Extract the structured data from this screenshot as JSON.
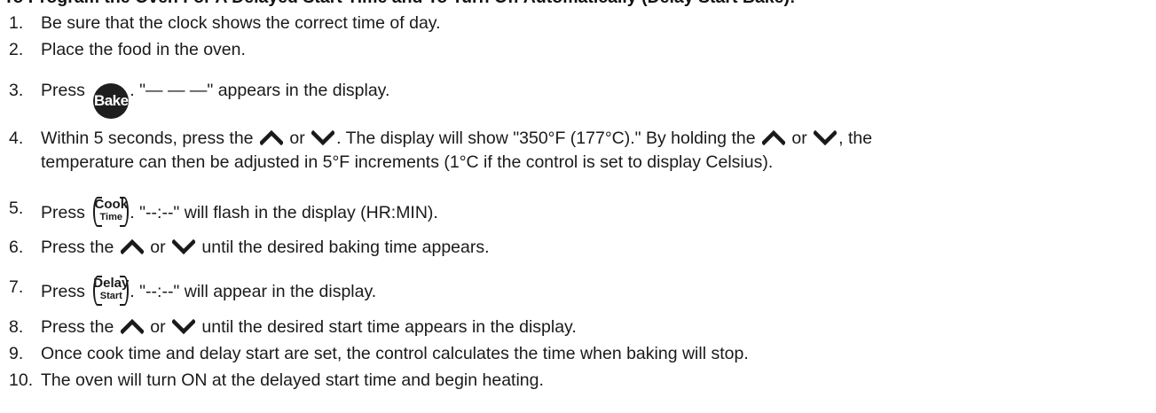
{
  "heading": "To Program the Oven For A Delayed Start Time and To Turn Off Automatically (Delay Start Bake):",
  "icons": {
    "up": "up-arrow-icon",
    "down": "down-arrow-icon"
  },
  "buttons": {
    "bake": "Bake",
    "cook_time": [
      "Cook",
      "Time"
    ],
    "delay_start": [
      "Delay",
      "Start"
    ]
  },
  "steps": [
    {
      "num": "1.",
      "text": "Be sure that the clock shows the correct time of day."
    },
    {
      "num": "2.",
      "text": "Place the food in the oven."
    },
    {
      "num": "3.",
      "before": "Press",
      "after": ". \"— — —\" appears in the display."
    },
    {
      "num": "4.",
      "a": "Within 5 seconds, press the",
      "or1": "or",
      "b": ". The display will show \"350°F (177°C).\" By holding the",
      "or2": "or",
      "c": ", the",
      "line2": "temperature can then be adjusted in 5°F increments (1°C if the control is set to display Celsius)."
    },
    {
      "num": "5.",
      "before": "Press",
      "after": ". \"--:--\" will flash in the display (HR:MIN)."
    },
    {
      "num": "6.",
      "before": "Press the",
      "or": "or",
      "after": "until the desired baking time appears."
    },
    {
      "num": "7.",
      "before": "Press",
      "after": ". \"--:--\" will appear in the display."
    },
    {
      "num": "8.",
      "before": "Press the",
      "or": "or",
      "after": "until the desired start time appears in the display."
    },
    {
      "num": "9.",
      "text": "Once cook time and delay start are set, the control calculates the time when baking will stop."
    },
    {
      "num": "10.",
      "text": "The oven will turn ON at the delayed start time and begin heating."
    }
  ]
}
